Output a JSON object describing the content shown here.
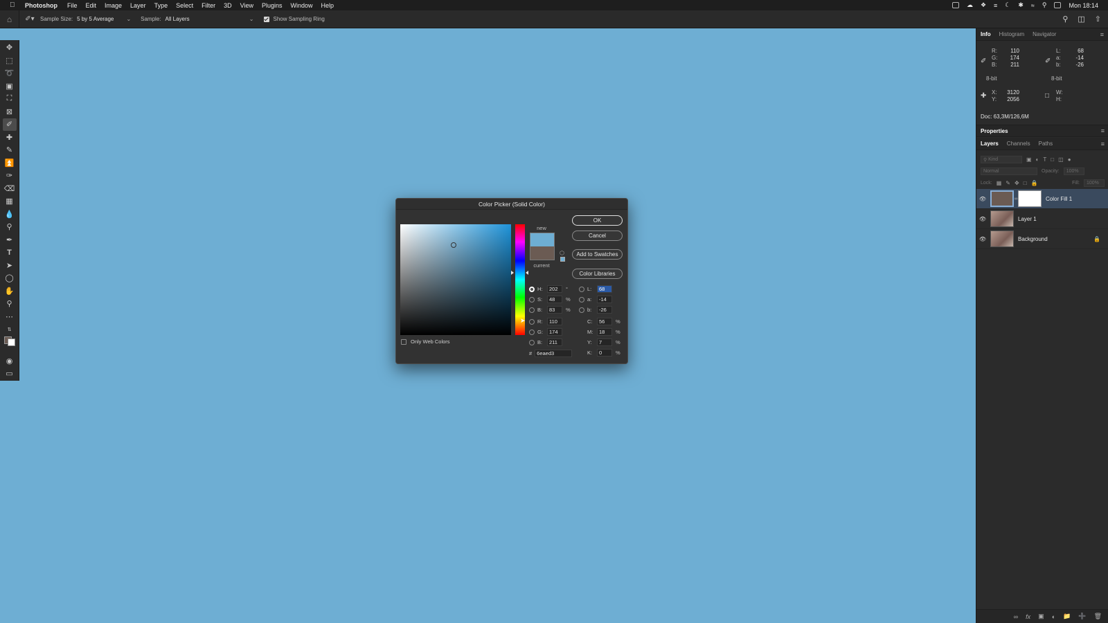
{
  "menubar": {
    "app": "Photoshop",
    "items": [
      "File",
      "Edit",
      "Image",
      "Layer",
      "Type",
      "Select",
      "Filter",
      "3D",
      "View",
      "Plugins",
      "Window",
      "Help"
    ],
    "clock": "Mon 18:14"
  },
  "options": {
    "sample_size_label": "Sample Size:",
    "sample_size_value": "5 by 5 Average",
    "sample_label": "Sample:",
    "sample_value": "All Layers",
    "show_ring": "Show Sampling Ring"
  },
  "info": {
    "tabs": [
      "Info",
      "Histogram",
      "Navigator"
    ],
    "rgb": [
      {
        "l": "R:",
        "v": "110"
      },
      {
        "l": "G:",
        "v": "174"
      },
      {
        "l": "B:",
        "v": "211"
      }
    ],
    "lab": [
      {
        "l": "L:",
        "v": "68"
      },
      {
        "l": "a:",
        "v": "-14"
      },
      {
        "l": "b:",
        "v": "-26"
      }
    ],
    "bit_left": "8-bit",
    "bit_right": "8-bit",
    "xy": [
      {
        "l": "X:",
        "v": "3120"
      },
      {
        "l": "Y:",
        "v": "2056"
      }
    ],
    "wh": [
      {
        "l": "W:",
        "v": ""
      },
      {
        "l": "H:",
        "v": ""
      }
    ],
    "doc": "Doc: 63,3M/126,6M"
  },
  "properties_title": "Properties",
  "layers": {
    "tabs": [
      "Layers",
      "Channels",
      "Paths"
    ],
    "kind": "Kind",
    "blend": "Normal",
    "opacity_label": "Opacity:",
    "opacity_value": "100%",
    "lock_label": "Lock:",
    "fill_label": "Fill:",
    "fill_value": "100%",
    "items": [
      {
        "name": "Color Fill 1"
      },
      {
        "name": "Layer 1"
      },
      {
        "name": "Background"
      }
    ]
  },
  "dialog": {
    "title": "Color Picker (Solid Color)",
    "new_label": "new",
    "current_label": "current",
    "ok": "OK",
    "cancel": "Cancel",
    "add_swatches": "Add to Swatches",
    "color_libraries": "Color Libraries",
    "only_web": "Only Web Colors",
    "hsb": [
      {
        "l": "H:",
        "v": "202",
        "u": "°"
      },
      {
        "l": "S:",
        "v": "48",
        "u": "%"
      },
      {
        "l": "B:",
        "v": "83",
        "u": "%"
      }
    ],
    "rgb": [
      {
        "l": "R:",
        "v": "110"
      },
      {
        "l": "G:",
        "v": "174"
      },
      {
        "l": "B:",
        "v": "211"
      }
    ],
    "lab": [
      {
        "l": "L:",
        "v": "68"
      },
      {
        "l": "a:",
        "v": "-14"
      },
      {
        "l": "b:",
        "v": "-26"
      }
    ],
    "cmyk": [
      {
        "l": "C:",
        "v": "56",
        "u": "%"
      },
      {
        "l": "M:",
        "v": "18",
        "u": "%"
      },
      {
        "l": "Y:",
        "v": "7",
        "u": "%"
      },
      {
        "l": "K:",
        "v": "0",
        "u": "%"
      }
    ],
    "hex_label": "#",
    "hex": "6eaed3"
  },
  "colors": {
    "canvas": "#6eaed3",
    "current": "#6b5b53",
    "new": "#6eaed3"
  }
}
